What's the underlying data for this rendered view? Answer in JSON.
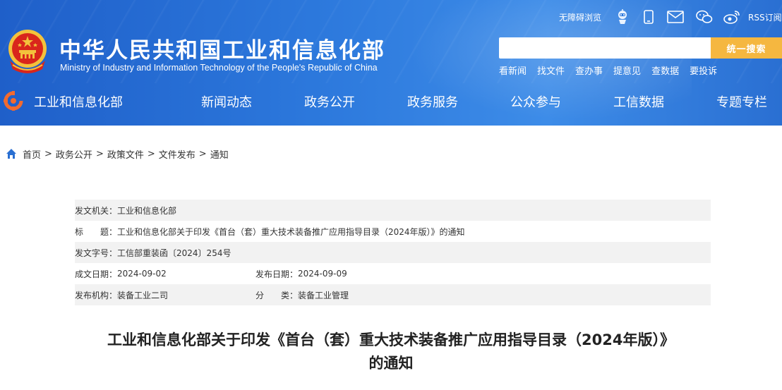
{
  "site": {
    "title": "中华人民共和国工业和信息化部",
    "subtitle": "Ministry of Industry and Information Technology of the People's Republic of China"
  },
  "top_bar": {
    "accessibility": "无障碍浏览",
    "rss": "RSS订阅",
    "icons": [
      "robot-assistant-icon",
      "mobile-phone-icon",
      "mail-icon",
      "wechat-icon",
      "weibo-icon"
    ]
  },
  "search": {
    "placeholder": "",
    "button_label": "统一搜索"
  },
  "quick_links": [
    "看新闻",
    "找文件",
    "查办事",
    "提意见",
    "查数据",
    "要投诉"
  ],
  "nav": {
    "items": [
      "工业和信息化部",
      "新闻动态",
      "政务公开",
      "政务服务",
      "公众参与",
      "工信数据",
      "专题专栏"
    ]
  },
  "breadcrumb": {
    "items": [
      "首页",
      "政务公开",
      "政策文件",
      "文件发布",
      "通知"
    ],
    "separator": ">"
  },
  "document_info": {
    "issuer_label": "发文机关：",
    "issuer": "工业和信息化部",
    "title_label": "标　　题：",
    "title": "工业和信息化部关于印发《首台（套）重大技术装备推广应用指导目录（2024年版）》的通知",
    "doc_number_label": "发文字号：",
    "doc_number": "工信部重装函〔2024〕254号",
    "created_label": "成文日期：",
    "created": "2024-09-02",
    "published_label": "发布日期：",
    "published": "2024-09-09",
    "agency_label": "发布机构：",
    "agency": "装备工业二司",
    "category_label": "分　　类：",
    "category": "装备工业管理"
  },
  "article": {
    "title_line1": "工业和信息化部关于印发《首台（套）重大技术装备推广应用指导目录（2024年版）》",
    "title_line2": "的通知"
  },
  "colors": {
    "header_blue": "#2c78dc",
    "search_button": "#f5b740",
    "row_shade": "#f2f2f2",
    "breadcrumb_icon": "#2a6fd2"
  }
}
